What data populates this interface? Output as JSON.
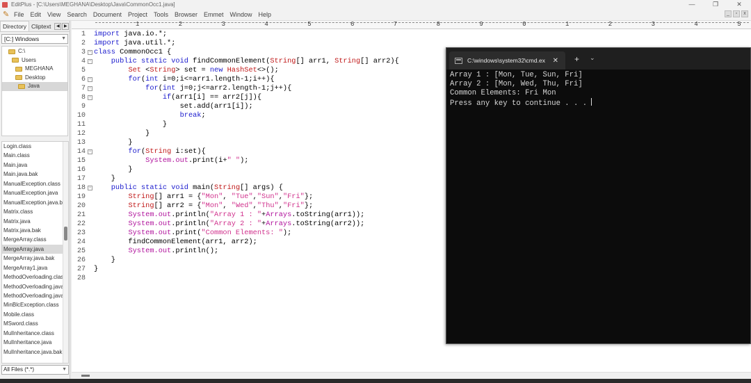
{
  "window": {
    "title": "EditPlus - [C:\\Users\\MEGHANA\\Desktop\\Java\\CommonOcc1.java]",
    "controls": [
      "—",
      "❐",
      "✕"
    ]
  },
  "menu": {
    "items": [
      "File",
      "Edit",
      "View",
      "Search",
      "Document",
      "Project",
      "Tools",
      "Browser",
      "Emmet",
      "Window",
      "Help"
    ],
    "right_buttons": [
      "_",
      "▫",
      "x"
    ]
  },
  "left_panel": {
    "tabs": [
      "Directory",
      "Cliptext"
    ],
    "drive": "[C:] Windows",
    "tree": [
      {
        "label": "C:\\",
        "indent": 0
      },
      {
        "label": "Users",
        "indent": 1
      },
      {
        "label": "MEGHANA",
        "indent": 2
      },
      {
        "label": "Desktop",
        "indent": 3
      },
      {
        "label": "Java",
        "indent": 4,
        "selected": true
      }
    ],
    "files": [
      "Login.class",
      "Main.class",
      "Main.java",
      "Main.java.bak",
      "ManualException.class",
      "ManualException.java",
      "ManualException.java.bak",
      "Matrix.class",
      "Matrix.java",
      "Matrix.java.bak",
      "MergeArray.class",
      "MergeArray.java",
      "MergeArray.java.bak",
      "MergeArray1.java",
      "MethodOverloading.class",
      "MethodOverloading.java",
      "MethodOverloading.java.bak",
      "MinBlcException.class",
      "Mobile.class",
      "MSword.class",
      "MulInheritance.class",
      "MulInheritance.java",
      "MulInheritance.java.bak"
    ],
    "selected_file": "MergeArray.java",
    "filter": "All Files (*.*)"
  },
  "ruler": {
    "marks": [
      "1",
      "2",
      "3",
      "4",
      "5",
      "6",
      "7",
      "8",
      "9",
      "0",
      "1",
      "2",
      "3",
      "4",
      "5"
    ]
  },
  "editor": {
    "lines": [
      "import java.io.*;",
      "import java.util.*;",
      "class CommonOcc1 {",
      "    public static void findCommonElement(String[] arr1, String[] arr2){",
      "        Set <String> set = new HashSet<>();",
      "        for(int i=0;i<=arr1.length-1;i++){",
      "            for(int j=0;j<=arr2.length-1;j++){",
      "                if(arr1[i] == arr2[j]){",
      "                    set.add(arr1[i]);",
      "                    break;",
      "                }",
      "            }",
      "        }",
      "        for(String i:set){",
      "            System.out.print(i+\" \");",
      "        }",
      "    }",
      "    public static void main(String[] args) {",
      "        String[] arr1 = {\"Mon\", \"Tue\",\"Sun\",\"Fri\"};",
      "        String[] arr2 = {\"Mon\", \"Wed\",\"Thu\",\"Fri\"};",
      "        System.out.println(\"Array 1 : \"+Arrays.toString(arr1));",
      "        System.out.println(\"Array 2 : \"+Arrays.toString(arr2));",
      "        System.out.print(\"Common Elements: \");",
      "        findCommonElement(arr1, arr2);",
      "        System.out.println();",
      "    }",
      "}",
      ""
    ],
    "fold_lines": [
      3,
      4,
      6,
      7,
      8,
      14,
      18
    ]
  },
  "terminal": {
    "tab_title": "C:\\windows\\system32\\cmd.ex",
    "new_tab": "+",
    "dropdown": "⌄",
    "output": [
      "Array 1 : [Mon, Tue, Sun, Fri]",
      "Array 2 : [Mon, Wed, Thu, Fri]",
      "Common Elements: Fri Mon",
      "Press any key to continue . . . "
    ]
  },
  "colors": {
    "keyword": "#1a1acd",
    "type": "#c01818",
    "string": "#d0308c",
    "object": "#b0129c",
    "terminal_bg": "#0c0c0c",
    "terminal_text": "#d6d6d6"
  },
  "icons": [
    "editplus-logo-icon",
    "pen-icon",
    "folder-icon",
    "terminal-icon",
    "close-icon",
    "chevron-down-icon"
  ]
}
